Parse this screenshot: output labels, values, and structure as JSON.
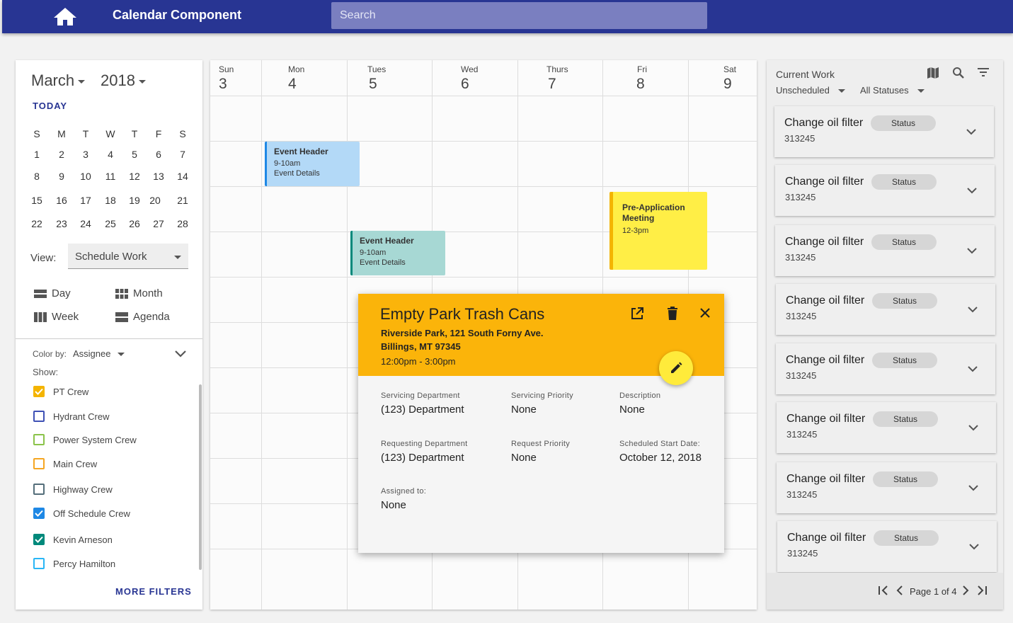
{
  "header": {
    "title": "Calendar Component",
    "search_placeholder": "Search",
    "home_icon": "home-icon",
    "color": "#283593"
  },
  "sidebar": {
    "month": "March",
    "year": "2018",
    "today_label": "TODAY",
    "weekdays": [
      "S",
      "M",
      "T",
      "W",
      "T",
      "F",
      "S"
    ],
    "weeks": [
      [
        "1",
        "2",
        "3",
        "4",
        "5",
        "6",
        "7"
      ],
      [
        "8",
        "9",
        "10",
        "11",
        "12",
        "13",
        "14"
      ],
      [
        "15",
        "16",
        "17",
        "18",
        "19",
        "20",
        "21"
      ],
      [
        "22",
        "23",
        "24",
        "25",
        "26",
        "27",
        "28"
      ]
    ],
    "view_label": "View:",
    "view_value": "Schedule Work",
    "view_options": [
      "Day",
      "Month",
      "Week",
      "Agenda"
    ],
    "color_by_label": "Color by:",
    "color_by_value": "Assignee",
    "show_label": "Show:",
    "filters": [
      {
        "label": "PT Crew",
        "checked": true,
        "color": "#f4b400"
      },
      {
        "label": "Hydrant Crew",
        "checked": false,
        "color": "#3f51b5"
      },
      {
        "label": "Power System Crew",
        "checked": false,
        "color": "#8bc34a"
      },
      {
        "label": "Main Crew",
        "checked": false,
        "color": "#f5a623"
      },
      {
        "label": "Highway Crew",
        "checked": false,
        "color": "#546e7a"
      },
      {
        "label": "Off Schedule Crew",
        "checked": true,
        "color": "#1e88e5"
      },
      {
        "label": "Kevin Arneson",
        "checked": true,
        "color": "#00897b"
      },
      {
        "label": "Percy Hamilton",
        "checked": false,
        "color": "#29b6f6"
      }
    ],
    "more_filters": "MORE FILTERS"
  },
  "calendar": {
    "days": [
      {
        "name": "Sun",
        "num": "3"
      },
      {
        "name": "Mon",
        "num": "4"
      },
      {
        "name": "Tues",
        "num": "5"
      },
      {
        "name": "Wed",
        "num": "6"
      },
      {
        "name": "Thurs",
        "num": "7"
      },
      {
        "name": "Fri",
        "num": "8"
      },
      {
        "name": "Sat",
        "num": "9"
      }
    ],
    "events": [
      {
        "header": "Event Header",
        "time": "9-10am",
        "details": "Event Details",
        "bg": "#b3d9f7",
        "accent": "#1e88e5"
      },
      {
        "header": "Event Header",
        "time": "9-10am",
        "details": "Event Details",
        "bg": "#a7d8d4",
        "accent": "#00897b"
      },
      {
        "header": "Pre-Application Meeting",
        "time": "12-3pm",
        "details": "",
        "bg": "#ffee46",
        "accent": "#f4b400"
      }
    ]
  },
  "popup": {
    "title": "Empty Park Trash Cans",
    "address1": "Riverside Park, 121 South Forny Ave.",
    "address2": "Billings, MT 97345",
    "time": "12:00pm - 3:00pm",
    "header_color": "#fbb40a",
    "fields": [
      {
        "label": "Servicing Department",
        "value": "(123) Department"
      },
      {
        "label": "Servicing Priority",
        "value": "None"
      },
      {
        "label": "Description",
        "value": "None"
      },
      {
        "label": "Requesting Department",
        "value": "(123) Department"
      },
      {
        "label": "Request Priority",
        "value": "None"
      },
      {
        "label": "Scheduled Start Date:",
        "value": "October 12, 2018"
      },
      {
        "label": "Assigned to:",
        "value": "None"
      }
    ]
  },
  "work": {
    "title": "Current Work",
    "filter1": "Unscheduled",
    "filter2": "All Statuses",
    "items": [
      {
        "title": "Change oil filter",
        "id": "313245",
        "status": "Status"
      },
      {
        "title": "Change oil filter",
        "id": "313245",
        "status": "Status"
      },
      {
        "title": "Change oil filter",
        "id": "313245",
        "status": "Status"
      },
      {
        "title": "Change oil filter",
        "id": "313245",
        "status": "Status"
      },
      {
        "title": "Change oil filter",
        "id": "313245",
        "status": "Status"
      },
      {
        "title": "Change oil filter",
        "id": "313245",
        "status": "Status"
      },
      {
        "title": "Change oil filter",
        "id": "313245",
        "status": "Status"
      },
      {
        "title": "Change oil filter",
        "id": "313245",
        "status": "Status"
      }
    ],
    "page_text": "Page 1 of 4"
  }
}
